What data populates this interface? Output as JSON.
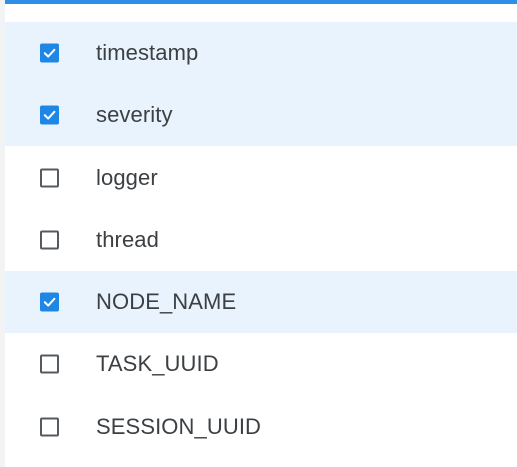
{
  "colors": {
    "accent": "#1e87e5",
    "selected_row_bg": "#e9f3fd",
    "top_border": "#2f8fe8",
    "text": "#3c4043"
  },
  "columns_menu": {
    "items": [
      {
        "label": "timestamp",
        "checked": true
      },
      {
        "label": "severity",
        "checked": true
      },
      {
        "label": "logger",
        "checked": false
      },
      {
        "label": "thread",
        "checked": false
      },
      {
        "label": "NODE_NAME",
        "checked": true
      },
      {
        "label": "TASK_UUID",
        "checked": false
      },
      {
        "label": "SESSION_UUID",
        "checked": false
      }
    ]
  }
}
